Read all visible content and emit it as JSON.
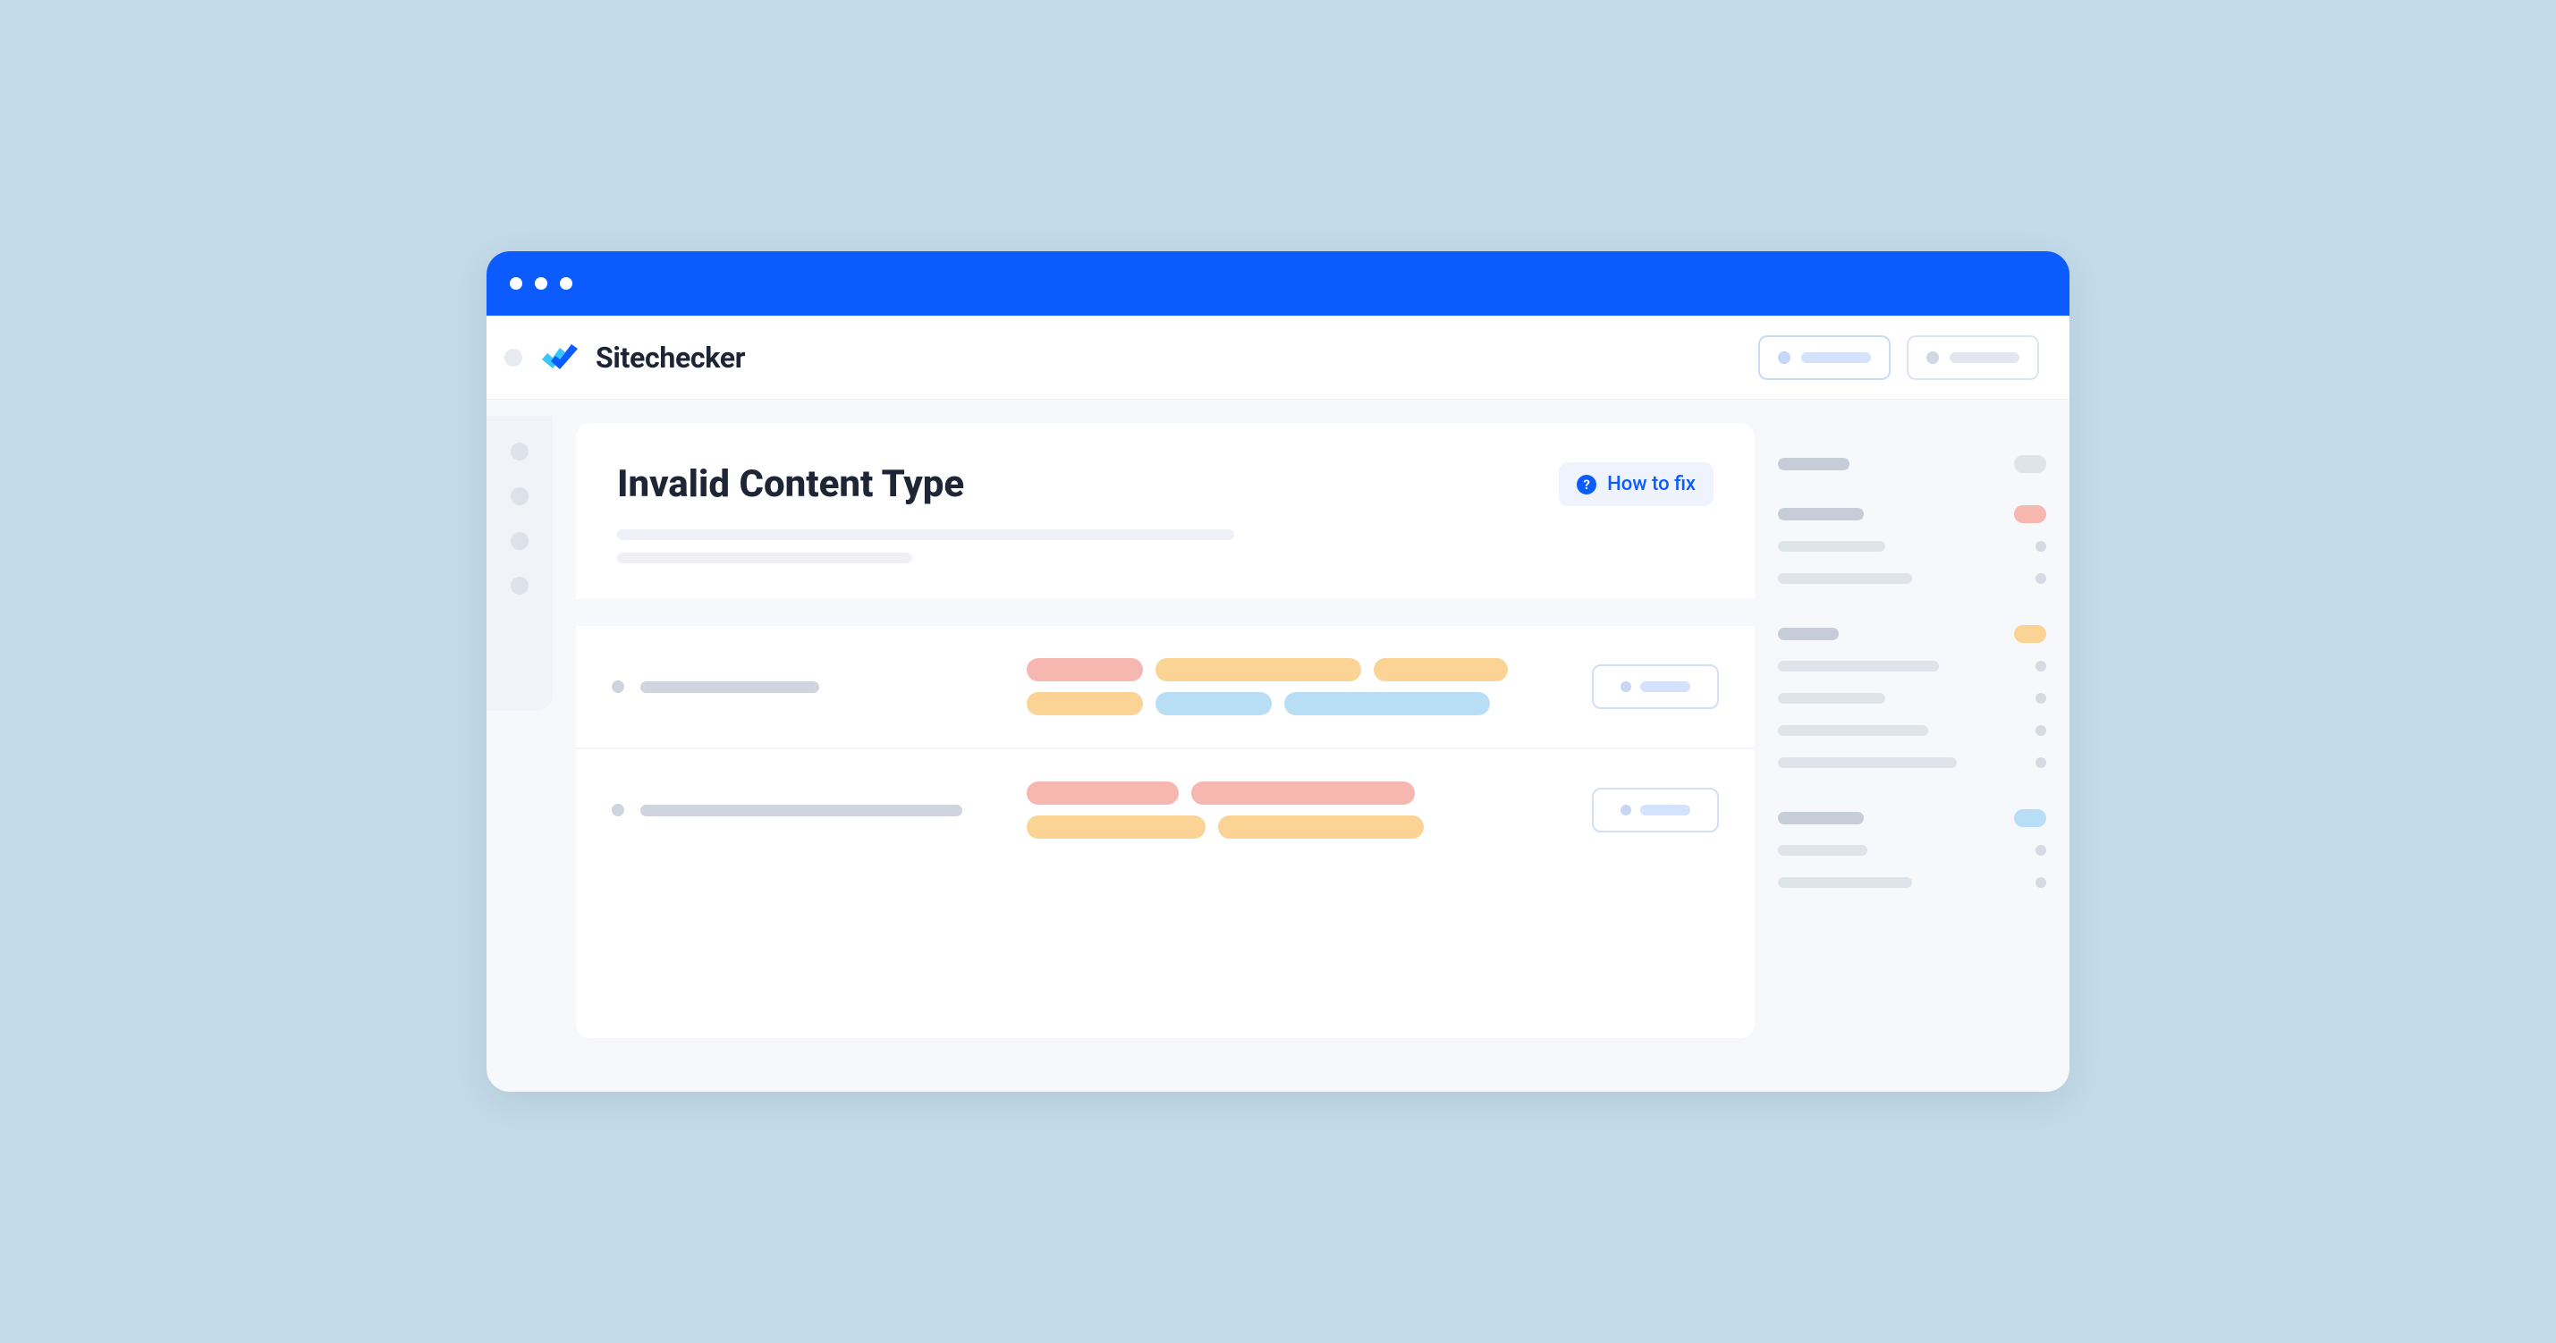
{
  "brand": "Sitechecker",
  "page": {
    "title": "Invalid Content Type",
    "how_to_fix_label": "How to fix"
  }
}
